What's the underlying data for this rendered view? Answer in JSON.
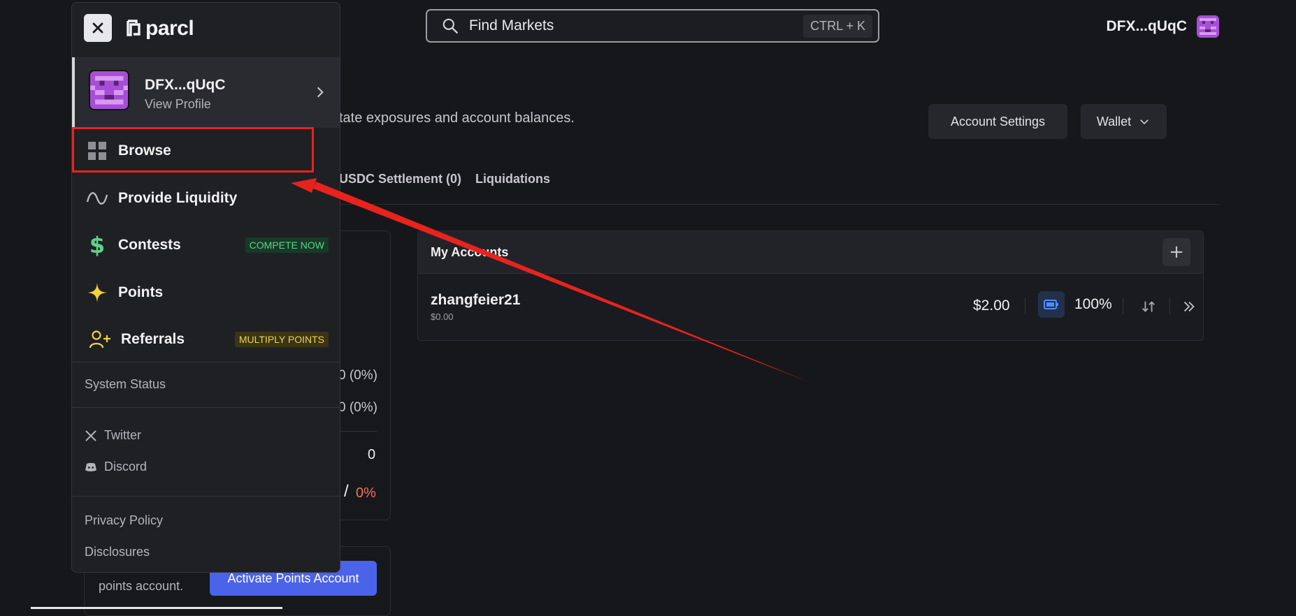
{
  "search": {
    "placeholder": "Find Markets",
    "shortcut": "CTRL + K"
  },
  "top_user": {
    "name": "DFX...qUqC"
  },
  "page": {
    "subtitle_fragment": "tate exposures and account balances.",
    "account_settings_label": "Account Settings",
    "wallet_label": "Wallet",
    "tabs": [
      "USDC Settlement (0)",
      "Liquidations"
    ]
  },
  "stats": {
    "row1": "0 (0%)",
    "row2": "0 (0%)",
    "row3": "0",
    "row4_sep": "/",
    "row4_pct": "0%"
  },
  "points_panel": {
    "text_line2": "points account.",
    "activate_label": "Activate Points Account"
  },
  "accounts": {
    "title": "My Accounts",
    "add_label": "+",
    "rows": [
      {
        "name": "zhangfeier21",
        "sub": "$0.00",
        "balance": "$2.00",
        "health": "100%"
      }
    ]
  },
  "menu": {
    "logo_text": "parcl",
    "profile": {
      "name": "DFX...qUqC",
      "link": "View Profile"
    },
    "items": [
      {
        "label": "Browse",
        "icon": "grid-icon"
      },
      {
        "label": "Provide Liquidity",
        "icon": "wave-icon"
      },
      {
        "label": "Contests",
        "icon": "dollar-icon",
        "badge": "COMPETE NOW"
      },
      {
        "label": "Points",
        "icon": "sparkle-icon"
      },
      {
        "label": "Referrals",
        "icon": "user-plus-icon",
        "badge": "MULTIPLY POINTS"
      }
    ],
    "system_status": "System Status",
    "social": [
      {
        "label": "Twitter",
        "icon": "x-logo-icon"
      },
      {
        "label": "Discord",
        "icon": "discord-icon"
      }
    ],
    "legal": [
      "Privacy Policy",
      "Disclosures"
    ]
  },
  "colors": {
    "accent_blue": "#4b63e8",
    "annotation_red": "#e8231d",
    "green_badge": "#5ed28a",
    "yellow_badge": "#f0d24a",
    "avatar_purple": "#a64fd6"
  }
}
